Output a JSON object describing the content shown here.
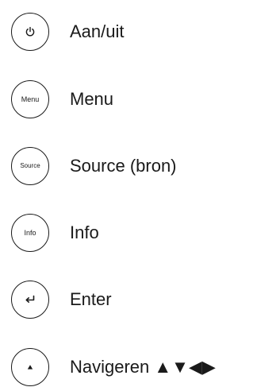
{
  "legend": {
    "items": [
      {
        "icon": "power-icon",
        "button_text": "",
        "label": "Aan/uit"
      },
      {
        "icon": "",
        "button_text": "Menu",
        "label": "Menu"
      },
      {
        "icon": "",
        "button_text": "Source",
        "label": "Source (bron)"
      },
      {
        "icon": "",
        "button_text": "Info",
        "label": "Info"
      },
      {
        "icon": "enter-arrow-icon",
        "button_text": "",
        "label": "Enter"
      },
      {
        "icon": "up-triangle-icon",
        "button_text": "",
        "label": "Navigeren ▲▼◀▶"
      }
    ]
  }
}
